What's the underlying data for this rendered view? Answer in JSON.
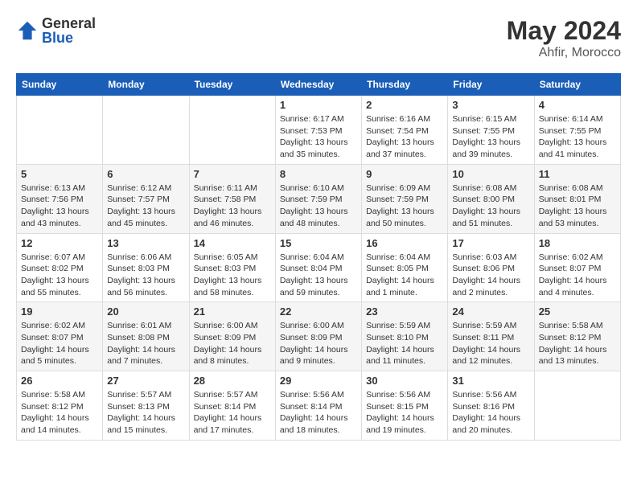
{
  "logo": {
    "general": "General",
    "blue": "Blue"
  },
  "header": {
    "month_year": "May 2024",
    "location": "Ahfir, Morocco"
  },
  "weekdays": [
    "Sunday",
    "Monday",
    "Tuesday",
    "Wednesday",
    "Thursday",
    "Friday",
    "Saturday"
  ],
  "weeks": [
    [
      {
        "day": "",
        "info": ""
      },
      {
        "day": "",
        "info": ""
      },
      {
        "day": "",
        "info": ""
      },
      {
        "day": "1",
        "info": "Sunrise: 6:17 AM\nSunset: 7:53 PM\nDaylight: 13 hours\nand 35 minutes."
      },
      {
        "day": "2",
        "info": "Sunrise: 6:16 AM\nSunset: 7:54 PM\nDaylight: 13 hours\nand 37 minutes."
      },
      {
        "day": "3",
        "info": "Sunrise: 6:15 AM\nSunset: 7:55 PM\nDaylight: 13 hours\nand 39 minutes."
      },
      {
        "day": "4",
        "info": "Sunrise: 6:14 AM\nSunset: 7:55 PM\nDaylight: 13 hours\nand 41 minutes."
      }
    ],
    [
      {
        "day": "5",
        "info": "Sunrise: 6:13 AM\nSunset: 7:56 PM\nDaylight: 13 hours\nand 43 minutes."
      },
      {
        "day": "6",
        "info": "Sunrise: 6:12 AM\nSunset: 7:57 PM\nDaylight: 13 hours\nand 45 minutes."
      },
      {
        "day": "7",
        "info": "Sunrise: 6:11 AM\nSunset: 7:58 PM\nDaylight: 13 hours\nand 46 minutes."
      },
      {
        "day": "8",
        "info": "Sunrise: 6:10 AM\nSunset: 7:59 PM\nDaylight: 13 hours\nand 48 minutes."
      },
      {
        "day": "9",
        "info": "Sunrise: 6:09 AM\nSunset: 7:59 PM\nDaylight: 13 hours\nand 50 minutes."
      },
      {
        "day": "10",
        "info": "Sunrise: 6:08 AM\nSunset: 8:00 PM\nDaylight: 13 hours\nand 51 minutes."
      },
      {
        "day": "11",
        "info": "Sunrise: 6:08 AM\nSunset: 8:01 PM\nDaylight: 13 hours\nand 53 minutes."
      }
    ],
    [
      {
        "day": "12",
        "info": "Sunrise: 6:07 AM\nSunset: 8:02 PM\nDaylight: 13 hours\nand 55 minutes."
      },
      {
        "day": "13",
        "info": "Sunrise: 6:06 AM\nSunset: 8:03 PM\nDaylight: 13 hours\nand 56 minutes."
      },
      {
        "day": "14",
        "info": "Sunrise: 6:05 AM\nSunset: 8:03 PM\nDaylight: 13 hours\nand 58 minutes."
      },
      {
        "day": "15",
        "info": "Sunrise: 6:04 AM\nSunset: 8:04 PM\nDaylight: 13 hours\nand 59 minutes."
      },
      {
        "day": "16",
        "info": "Sunrise: 6:04 AM\nSunset: 8:05 PM\nDaylight: 14 hours\nand 1 minute."
      },
      {
        "day": "17",
        "info": "Sunrise: 6:03 AM\nSunset: 8:06 PM\nDaylight: 14 hours\nand 2 minutes."
      },
      {
        "day": "18",
        "info": "Sunrise: 6:02 AM\nSunset: 8:07 PM\nDaylight: 14 hours\nand 4 minutes."
      }
    ],
    [
      {
        "day": "19",
        "info": "Sunrise: 6:02 AM\nSunset: 8:07 PM\nDaylight: 14 hours\nand 5 minutes."
      },
      {
        "day": "20",
        "info": "Sunrise: 6:01 AM\nSunset: 8:08 PM\nDaylight: 14 hours\nand 7 minutes."
      },
      {
        "day": "21",
        "info": "Sunrise: 6:00 AM\nSunset: 8:09 PM\nDaylight: 14 hours\nand 8 minutes."
      },
      {
        "day": "22",
        "info": "Sunrise: 6:00 AM\nSunset: 8:09 PM\nDaylight: 14 hours\nand 9 minutes."
      },
      {
        "day": "23",
        "info": "Sunrise: 5:59 AM\nSunset: 8:10 PM\nDaylight: 14 hours\nand 11 minutes."
      },
      {
        "day": "24",
        "info": "Sunrise: 5:59 AM\nSunset: 8:11 PM\nDaylight: 14 hours\nand 12 minutes."
      },
      {
        "day": "25",
        "info": "Sunrise: 5:58 AM\nSunset: 8:12 PM\nDaylight: 14 hours\nand 13 minutes."
      }
    ],
    [
      {
        "day": "26",
        "info": "Sunrise: 5:58 AM\nSunset: 8:12 PM\nDaylight: 14 hours\nand 14 minutes."
      },
      {
        "day": "27",
        "info": "Sunrise: 5:57 AM\nSunset: 8:13 PM\nDaylight: 14 hours\nand 15 minutes."
      },
      {
        "day": "28",
        "info": "Sunrise: 5:57 AM\nSunset: 8:14 PM\nDaylight: 14 hours\nand 17 minutes."
      },
      {
        "day": "29",
        "info": "Sunrise: 5:56 AM\nSunset: 8:14 PM\nDaylight: 14 hours\nand 18 minutes."
      },
      {
        "day": "30",
        "info": "Sunrise: 5:56 AM\nSunset: 8:15 PM\nDaylight: 14 hours\nand 19 minutes."
      },
      {
        "day": "31",
        "info": "Sunrise: 5:56 AM\nSunset: 8:16 PM\nDaylight: 14 hours\nand 20 minutes."
      },
      {
        "day": "",
        "info": ""
      }
    ]
  ]
}
